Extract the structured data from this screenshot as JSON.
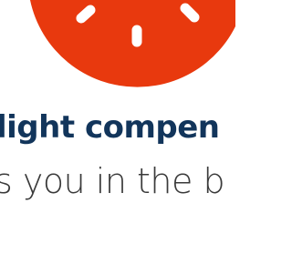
{
  "hero": {
    "icon": "sun-icon",
    "icon_color": "#e8390e",
    "icon_ray_color": "#ffffff"
  },
  "headline": {
    "text": "light compen",
    "color": "#12355b"
  },
  "subline": {
    "text": "s you in the b",
    "color": "#3a3a3a"
  }
}
